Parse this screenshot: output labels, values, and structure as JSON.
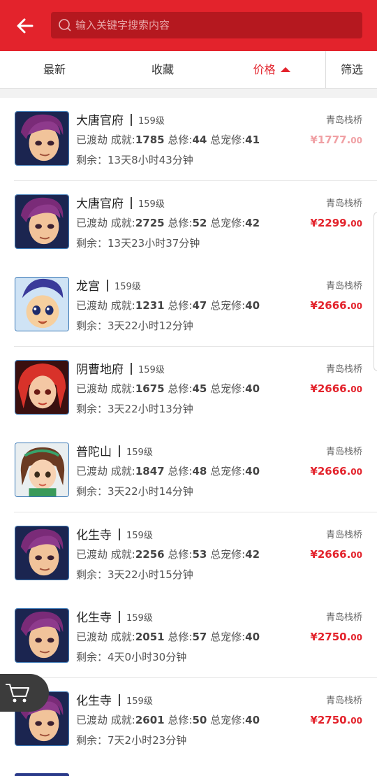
{
  "header": {
    "search_placeholder": "输入关键字搜索内容"
  },
  "tabs": [
    {
      "label": "最新",
      "active": false
    },
    {
      "label": "收藏",
      "active": false
    },
    {
      "label": "价格",
      "active": true,
      "sort": "ascending"
    },
    {
      "label": "筛选",
      "active": false
    }
  ],
  "list_labels": {
    "stats_prefix": "已渡劫",
    "achievement_label": "成就:",
    "cultivation_label": "总修:",
    "pet_cultivation_label": "总宠修:",
    "remaining_label": "剩余："
  },
  "items": [
    {
      "school": "大唐官府",
      "level": "159级",
      "achievement": "1785",
      "cultivation": "44",
      "pet_cultivation": "41",
      "remaining": "13天8小时43分钟",
      "server": "青岛栈桥",
      "price_int": "¥1777.",
      "price_dec": "00",
      "faded": true,
      "avatar": "swordsman-icon"
    },
    {
      "school": "大唐官府",
      "level": "159级",
      "achievement": "2725",
      "cultivation": "52",
      "pet_cultivation": "42",
      "remaining": "13天23小时37分钟",
      "server": "青岛栈桥",
      "price_int": "¥2299.",
      "price_dec": "00",
      "faded": false,
      "avatar": "swordsman-icon"
    },
    {
      "school": "龙宫",
      "level": "159级",
      "achievement": "1231",
      "cultivation": "47",
      "pet_cultivation": "40",
      "remaining": "3天22小时12分钟",
      "server": "青岛栈桥",
      "price_int": "¥2666.",
      "price_dec": "00",
      "faded": false,
      "avatar": "boy-icon"
    },
    {
      "school": "阴曹地府",
      "level": "159级",
      "achievement": "1675",
      "cultivation": "45",
      "pet_cultivation": "40",
      "remaining": "3天22小时13分钟",
      "server": "青岛栈桥",
      "price_int": "¥2666.",
      "price_dec": "00",
      "faded": false,
      "avatar": "redhair-girl-icon"
    },
    {
      "school": "普陀山",
      "level": "159级",
      "achievement": "1847",
      "cultivation": "48",
      "pet_cultivation": "40",
      "remaining": "3天22小时14分钟",
      "server": "青岛栈桥",
      "price_int": "¥2666.",
      "price_dec": "00",
      "faded": false,
      "avatar": "girl-icon"
    },
    {
      "school": "化生寺",
      "level": "159级",
      "achievement": "2256",
      "cultivation": "53",
      "pet_cultivation": "42",
      "remaining": "3天22小时15分钟",
      "server": "青岛栈桥",
      "price_int": "¥2666.",
      "price_dec": "00",
      "faded": false,
      "avatar": "swordsman-icon"
    },
    {
      "school": "化生寺",
      "level": "159级",
      "achievement": "2051",
      "cultivation": "57",
      "pet_cultivation": "40",
      "remaining": "4天0小时30分钟",
      "server": "青岛栈桥",
      "price_int": "¥2750.",
      "price_dec": "00",
      "faded": false,
      "avatar": "swordsman-icon"
    },
    {
      "school": "化生寺",
      "level": "159级",
      "achievement": "2601",
      "cultivation": "50",
      "pet_cultivation": "40",
      "remaining": "7天2小时23分钟",
      "server": "青岛栈桥",
      "price_int": "¥2750.",
      "price_dec": "00",
      "faded": false,
      "avatar": "swordsman-icon"
    }
  ],
  "colors": {
    "accent": "#e3232c",
    "header_search": "#b5181f"
  }
}
